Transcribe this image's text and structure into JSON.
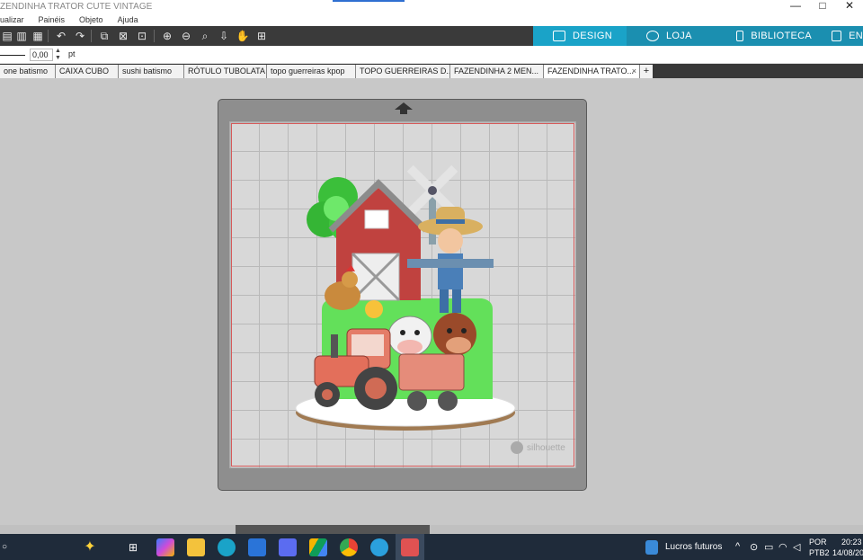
{
  "window": {
    "title": "ZENDINHA TRATOR CUTE VINTAGE",
    "controls": [
      "—",
      "□",
      "✕"
    ]
  },
  "menu": [
    "ualizar",
    "Painéis",
    "Objeto",
    "Ajuda"
  ],
  "toolbar": {
    "tools": [
      "paste-icon",
      "clipboard-icon",
      "undo-icon",
      "redo-icon",
      "group-icon",
      "ungroup-icon",
      "select-all-icon",
      "zoom-in-icon",
      "zoom-out-icon",
      "zoom-fit-icon",
      "move-down-icon",
      "pan-hand-icon",
      "add-page-icon"
    ],
    "nav_tabs": [
      {
        "label": "DESIGN",
        "icon": "grid-icon"
      },
      {
        "label": "LOJA",
        "icon": "store-icon"
      },
      {
        "label": "BIBLIOTECA",
        "icon": "download-icon"
      },
      {
        "label": "EN",
        "icon": "send-icon"
      }
    ]
  },
  "properties": {
    "line_width": "0,00",
    "unit": "pt"
  },
  "doc_tabs": [
    {
      "label": "one batismo",
      "close": ""
    },
    {
      "label": "CAIXA CUBO",
      "close": ""
    },
    {
      "label": "sushi batismo",
      "close": ""
    },
    {
      "label": "RÓTULO TUBOLATA",
      "close": ""
    },
    {
      "label": "topo guerreiras kpop",
      "close": ""
    },
    {
      "label": "TOPO GUERREIRAS D...",
      "close": ""
    },
    {
      "label": "FAZENDINHA 2 MEN...",
      "close": ""
    },
    {
      "label": "FAZENDINHA TRATO...",
      "close": "×"
    }
  ],
  "doc_tab_add": "+",
  "mat": {
    "watermark": "silhouette"
  },
  "taskbar": {
    "weather": "Lucros futuros",
    "language": "POR",
    "layout": "PTB2",
    "time": "20:23",
    "date": "14/08/20"
  },
  "colors": {
    "accent": "#1aa3c8",
    "toolbar_bg": "#3a3a3a",
    "taskbar_bg": "#1f2b3a"
  }
}
